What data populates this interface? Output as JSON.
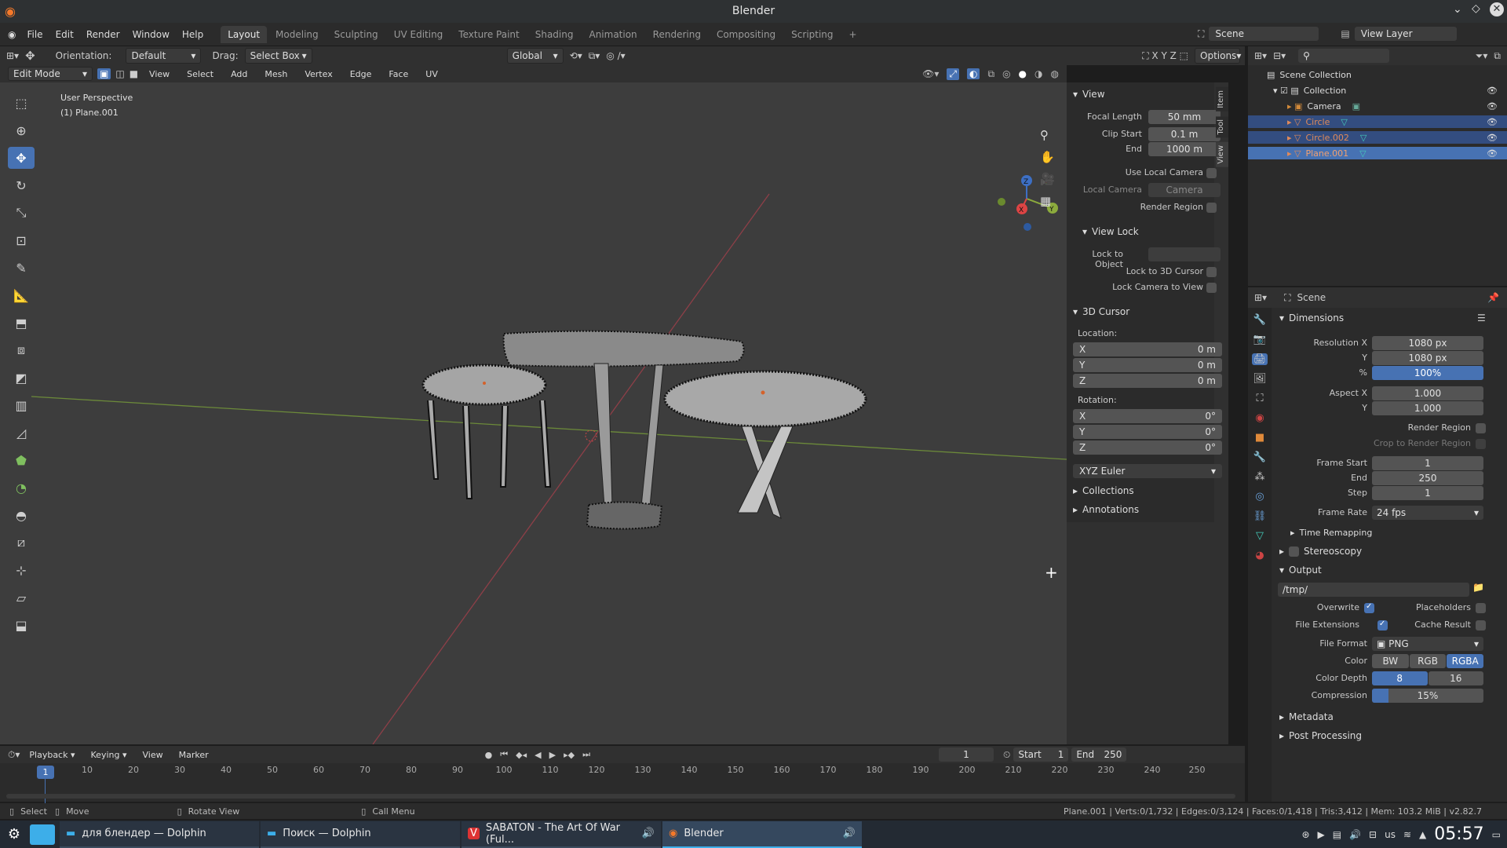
{
  "window": {
    "title": "Blender"
  },
  "menu": {
    "items": [
      "File",
      "Edit",
      "Render",
      "Window",
      "Help"
    ]
  },
  "workspaces": [
    "Layout",
    "Modeling",
    "Sculpting",
    "UV Editing",
    "Texture Paint",
    "Shading",
    "Animation",
    "Rendering",
    "Compositing",
    "Scripting"
  ],
  "scene": {
    "label": "Scene",
    "view_layer": "View Layer"
  },
  "toolbar": {
    "orientation_label": "Orientation:",
    "orientation_value": "Default",
    "drag_label": "Drag:",
    "drag_value": "Select Box",
    "transform": "Global",
    "options": "Options"
  },
  "header": {
    "mode": "Edit Mode",
    "menus": [
      "View",
      "Select",
      "Add",
      "Mesh",
      "Vertex",
      "Edge",
      "Face",
      "UV"
    ]
  },
  "viewport": {
    "overlay_title": "User Perspective",
    "overlay_object": "(1) Plane.001"
  },
  "npanel": {
    "tabs": [
      "Item",
      "Tool",
      "View"
    ],
    "view_header": "View",
    "focal_label": "Focal Length",
    "focal_value": "50 mm",
    "clip_start_label": "Clip Start",
    "clip_start_value": "0.1 m",
    "clip_end_label": "End",
    "clip_end_value": "1000 m",
    "use_local_camera": "Use Local Camera",
    "local_camera_label": "Local Camera",
    "local_camera_value": "Camera",
    "render_region": "Render Region",
    "view_lock": "View Lock",
    "lock_object": "Lock to Object",
    "lock_cursor": "Lock to 3D Cursor",
    "lock_camera": "Lock Camera to View",
    "cursor_header": "3D Cursor",
    "location": "Location:",
    "loc": [
      {
        "axis": "X",
        "value": "0 m"
      },
      {
        "axis": "Y",
        "value": "0 m"
      },
      {
        "axis": "Z",
        "value": "0 m"
      }
    ],
    "rotation": "Rotation:",
    "rot": [
      {
        "axis": "X",
        "value": "0°"
      },
      {
        "axis": "Y",
        "value": "0°"
      },
      {
        "axis": "Z",
        "value": "0°"
      }
    ],
    "rot_mode": "XYZ Euler",
    "collections": "Collections",
    "annotations": "Annotations"
  },
  "outliner": {
    "root": "Scene Collection",
    "collection": "Collection",
    "items": [
      {
        "name": "Camera",
        "color": "#dddddd"
      },
      {
        "name": "Circle",
        "color": "#e08a5a"
      },
      {
        "name": "Circle.002",
        "color": "#e08a5a"
      },
      {
        "name": "Plane.001",
        "color": "#e08a5a"
      }
    ]
  },
  "properties": {
    "scene_label": "Scene",
    "dimensions": "Dimensions",
    "res_x_label": "Resolution X",
    "res_x": "1080 px",
    "res_y_label": "Y",
    "res_y": "1080 px",
    "res_pct_label": "%",
    "res_pct": "100%",
    "aspect_x_label": "Aspect X",
    "aspect_x": "1.000",
    "aspect_y_label": "Y",
    "aspect_y": "1.000",
    "render_region": "Render Region",
    "crop_region": "Crop to Render Region",
    "frame_start_label": "Frame Start",
    "frame_start": "1",
    "frame_end_label": "End",
    "frame_end": "250",
    "frame_step_label": "Step",
    "frame_step": "1",
    "frame_rate_label": "Frame Rate",
    "frame_rate": "24 fps",
    "time_remap": "Time Remapping",
    "stereoscopy": "Stereoscopy",
    "output": "Output",
    "output_path": "/tmp/",
    "overwrite": "Overwrite",
    "placeholders": "Placeholders",
    "file_ext": "File Extensions",
    "cache_result": "Cache Result",
    "file_format_label": "File Format",
    "file_format": "PNG",
    "color_label": "Color",
    "color_opts": [
      "BW",
      "RGB",
      "RGBA"
    ],
    "depth_label": "Color Depth",
    "depth_opts": [
      "8",
      "16"
    ],
    "compression_label": "Compression",
    "compression": "15%",
    "compression_level": 0.15,
    "metadata": "Metadata",
    "post_processing": "Post Processing"
  },
  "timeline": {
    "menus": [
      "Playback",
      "Keying",
      "View",
      "Marker"
    ],
    "current_frame": "1",
    "start_label": "Start",
    "start": "1",
    "end_label": "End",
    "end": "250",
    "ticks": [
      "1",
      "10",
      "20",
      "30",
      "40",
      "50",
      "60",
      "70",
      "80",
      "90",
      "100",
      "110",
      "120",
      "130",
      "140",
      "150",
      "160",
      "170",
      "180",
      "190",
      "200",
      "210",
      "220",
      "230",
      "240",
      "250"
    ]
  },
  "statusbar": {
    "select": "Select",
    "move": "Move",
    "rotate": "Rotate View",
    "call_menu": "Call Menu",
    "stats": "Plane.001 | Verts:0/1,732 | Edges:0/3,124 | Faces:0/1,418 | Tris:3,412 | Mem: 103.2 MiB | v2.82.7"
  },
  "taskbar": {
    "items": [
      "для блендер — Dolphin",
      "Поиск — Dolphin",
      "SABATON - The Art Of War (Ful...",
      "Blender"
    ],
    "lang": "us",
    "clock": "05:57"
  },
  "colors": {
    "accent": "#4772b3",
    "selected_row": "#334d80"
  }
}
